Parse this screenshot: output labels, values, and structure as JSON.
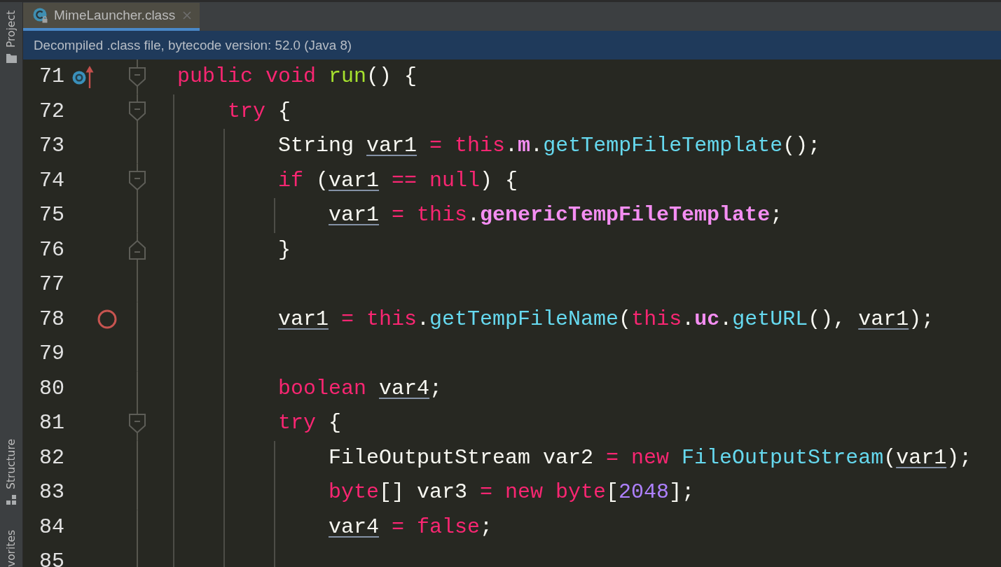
{
  "tool_strip": {
    "top": [
      {
        "label": "Project",
        "kind": "project",
        "selected": false
      }
    ],
    "bottom": [
      {
        "label": "Structure",
        "kind": "structure",
        "selected": false
      },
      {
        "label": "vorites",
        "kind": "favorites",
        "selected": false
      }
    ]
  },
  "tabs": [
    {
      "label": "MimeLauncher.class",
      "selected": true
    }
  ],
  "notice": {
    "text": "Decompiled .class file, bytecode version: 52.0 (Java 8)"
  },
  "editor": {
    "lines": [
      {
        "number": "71",
        "marker": {
          "kind": "override"
        },
        "fold": {
          "kind": "start"
        },
        "tokens": [
          {
            "text": "public ",
            "kind": "keyword"
          },
          {
            "text": "void ",
            "kind": "keyword"
          },
          {
            "text": "run",
            "kind": "declaration"
          },
          {
            "text": "() {",
            "kind": "plain"
          }
        ],
        "children": [
          {
            "number": "72",
            "fold": {
              "kind": "start"
            },
            "tokens": [
              {
                "text": "try ",
                "kind": "keyword"
              },
              {
                "text": "{",
                "kind": "plain"
              }
            ],
            "children": [
              {
                "number": "73",
                "tokens": [
                  {
                    "text": "String ",
                    "kind": "plain"
                  },
                  {
                    "text": "var1",
                    "kind": "reassigned"
                  },
                  {
                    "text": " = ",
                    "kind": "operator"
                  },
                  {
                    "text": "this",
                    "kind": "keyword"
                  },
                  {
                    "text": ".",
                    "kind": "plain"
                  },
                  {
                    "text": "m",
                    "kind": "field"
                  },
                  {
                    "text": ".",
                    "kind": "plain"
                  },
                  {
                    "text": "getTempFileTemplate",
                    "kind": "call"
                  },
                  {
                    "text": "();",
                    "kind": "plain"
                  }
                ]
              },
              {
                "number": "74",
                "fold": {
                  "kind": "start"
                },
                "tokens": [
                  {
                    "text": "if ",
                    "kind": "keyword"
                  },
                  {
                    "text": "(",
                    "kind": "plain"
                  },
                  {
                    "text": "var1",
                    "kind": "reassigned"
                  },
                  {
                    "text": " == ",
                    "kind": "operator"
                  },
                  {
                    "text": "null",
                    "kind": "keyword"
                  },
                  {
                    "text": ") {",
                    "kind": "plain"
                  }
                ],
                "children": [
                  {
                    "number": "75",
                    "tokens": [
                      {
                        "text": "var1",
                        "kind": "reassigned"
                      },
                      {
                        "text": " = ",
                        "kind": "operator"
                      },
                      {
                        "text": "this",
                        "kind": "keyword"
                      },
                      {
                        "text": ".",
                        "kind": "plain"
                      },
                      {
                        "text": "genericTempFileTemplate",
                        "kind": "field"
                      },
                      {
                        "text": ";",
                        "kind": "plain"
                      }
                    ]
                  }
                ]
              },
              {
                "number": "76",
                "fold": {
                  "kind": "end"
                },
                "tokens": [
                  {
                    "text": "}",
                    "kind": "plain"
                  }
                ]
              },
              {
                "number": "77"
              },
              {
                "number": "78",
                "marker": {
                  "kind": "breakpoint"
                },
                "tokens": [
                  {
                    "text": "var1",
                    "kind": "reassigned"
                  },
                  {
                    "text": " = ",
                    "kind": "operator"
                  },
                  {
                    "text": "this",
                    "kind": "keyword"
                  },
                  {
                    "text": ".",
                    "kind": "plain"
                  },
                  {
                    "text": "getTempFileName",
                    "kind": "call"
                  },
                  {
                    "text": "(",
                    "kind": "plain"
                  },
                  {
                    "text": "this",
                    "kind": "keyword"
                  },
                  {
                    "text": ".",
                    "kind": "plain"
                  },
                  {
                    "text": "uc",
                    "kind": "field"
                  },
                  {
                    "text": ".",
                    "kind": "plain"
                  },
                  {
                    "text": "getURL",
                    "kind": "call"
                  },
                  {
                    "text": "(), ",
                    "kind": "plain"
                  },
                  {
                    "text": "var1",
                    "kind": "reassigned"
                  },
                  {
                    "text": ");",
                    "kind": "plain"
                  }
                ]
              },
              {
                "number": "79"
              },
              {
                "number": "80",
                "tokens": [
                  {
                    "text": "boolean ",
                    "kind": "keyword"
                  },
                  {
                    "text": "var4",
                    "kind": "reassigned"
                  },
                  {
                    "text": ";",
                    "kind": "plain"
                  }
                ]
              },
              {
                "number": "81",
                "fold": {
                  "kind": "start"
                },
                "tokens": [
                  {
                    "text": "try ",
                    "kind": "keyword"
                  },
                  {
                    "text": "{",
                    "kind": "plain"
                  }
                ],
                "children": [
                  {
                    "number": "82",
                    "tokens": [
                      {
                        "text": "FileOutputStream var2",
                        "kind": "plain"
                      },
                      {
                        "text": " = ",
                        "kind": "operator"
                      },
                      {
                        "text": "new ",
                        "kind": "keyword"
                      },
                      {
                        "text": "FileOutputStream",
                        "kind": "call"
                      },
                      {
                        "text": "(",
                        "kind": "plain"
                      },
                      {
                        "text": "var1",
                        "kind": "reassigned"
                      },
                      {
                        "text": ");",
                        "kind": "plain"
                      }
                    ]
                  },
                  {
                    "number": "83",
                    "tokens": [
                      {
                        "text": "byte",
                        "kind": "keyword"
                      },
                      {
                        "text": "[] var3",
                        "kind": "plain"
                      },
                      {
                        "text": " = ",
                        "kind": "operator"
                      },
                      {
                        "text": "new ",
                        "kind": "keyword"
                      },
                      {
                        "text": "byte",
                        "kind": "keyword"
                      },
                      {
                        "text": "[",
                        "kind": "plain"
                      },
                      {
                        "text": "2048",
                        "kind": "number"
                      },
                      {
                        "text": "];",
                        "kind": "plain"
                      }
                    ]
                  },
                  {
                    "number": "84",
                    "tokens": [
                      {
                        "text": "var4",
                        "kind": "reassigned"
                      },
                      {
                        "text": " = ",
                        "kind": "operator"
                      },
                      {
                        "text": "false",
                        "kind": "keyword"
                      },
                      {
                        "text": ";",
                        "kind": "plain"
                      }
                    ]
                  },
                  {
                    "number": "85"
                  }
                ]
              }
            ]
          }
        ]
      }
    ]
  }
}
